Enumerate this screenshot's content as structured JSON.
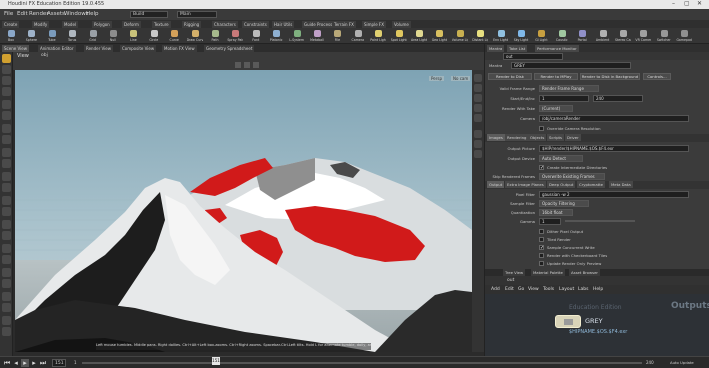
{
  "window": {
    "title": "Houdini FX Education Edition 19.0.455"
  },
  "menu": {
    "items": [
      "File",
      "Edit",
      "Render",
      "Assets",
      "Windows",
      "Help"
    ],
    "desktop": "Build",
    "network_field": "Main"
  },
  "shelf_tabs": [
    "Create",
    "Modify",
    "Model",
    "Polygon",
    "Deform",
    "Texture",
    "Rigging",
    "Characters",
    "Constraints",
    "Hair Utils",
    "Guide Process",
    "Terrain FX",
    "Simple FX",
    "Volume"
  ],
  "shelf_tools": [
    {
      "label": "Box",
      "color": "#8aa7c8"
    },
    {
      "label": "Sphere",
      "color": "#9fb3c9"
    },
    {
      "label": "Tube",
      "color": "#7a9bbc"
    },
    {
      "label": "Torus",
      "color": "#b0b8c0"
    },
    {
      "label": "Grid",
      "color": "#9aa0a6"
    },
    {
      "label": "Null",
      "color": "#8c8c8c"
    },
    {
      "label": "Line",
      "color": "#c9c27a"
    },
    {
      "label": "Circle",
      "color": "#c8c8c8"
    },
    {
      "label": "Curve",
      "color": "#d3a05a"
    },
    {
      "label": "Draw Curve",
      "color": "#d4b06a"
    },
    {
      "label": "Path",
      "color": "#a6b98c"
    },
    {
      "label": "Spray Paint",
      "color": "#c97a7a"
    },
    {
      "label": "Font",
      "color": "#bbbbbb"
    },
    {
      "label": "Platonic",
      "color": "#8fb0d1"
    },
    {
      "label": "L-System",
      "color": "#7fb07f"
    },
    {
      "label": "Metaball",
      "color": "#c0a0c8"
    },
    {
      "label": "File",
      "color": "#b8a878"
    },
    {
      "label": "Camera",
      "color": "#b0b0b0"
    },
    {
      "label": "Point Light",
      "color": "#e0d070"
    },
    {
      "label": "Spot Light",
      "color": "#e0c860"
    },
    {
      "label": "Area Light",
      "color": "#e0d890"
    },
    {
      "label": "Geo Light",
      "color": "#d8c060"
    },
    {
      "label": "Volume Light",
      "color": "#c8b050"
    },
    {
      "label": "Distant Light",
      "color": "#e8e080"
    },
    {
      "label": "Env Light",
      "color": "#90c0e0"
    },
    {
      "label": "Sky Light",
      "color": "#80b8e8"
    },
    {
      "label": "GI Light",
      "color": "#c8a040"
    },
    {
      "label": "Caustic",
      "color": "#a0c8a0"
    },
    {
      "label": "Portal",
      "color": "#9090c8"
    },
    {
      "label": "Ambient",
      "color": "#b0b0b0"
    },
    {
      "label": "Stereo Cam",
      "color": "#a8a8a8"
    },
    {
      "label": "VR Camera",
      "color": "#a0a0a0"
    },
    {
      "label": "Switcher",
      "color": "#989898"
    },
    {
      "label": "Gamepad",
      "color": "#909090"
    }
  ],
  "pane_tabs": [
    "Scene View",
    "Animation Editor",
    "Render View",
    "Composite View",
    "Motion FX View",
    "Geometry Spreadsheet"
  ],
  "viewport": {
    "label": "View",
    "path": "obj",
    "status_text": "Left mouse tumbles. Middle pans. Right dollies. Ctrl+Alt+Left box-zooms. Ctrl+Right zooms. Spacebar-Ctrl-Left tilts. Hold L for alternate tumble, dolly, and zoom.",
    "persp_label": "Persp",
    "cam_label": "No cam"
  },
  "timeline": {
    "current_frame": "151",
    "start": "1",
    "end": "240",
    "right_label": "Auto Update"
  },
  "params": {
    "tabs": [
      "Mantra",
      "Take List",
      "Performance Monitor"
    ],
    "path": "out",
    "node_type": "Mantra",
    "node_name": "GREY",
    "buttons": [
      "Render to Disk",
      "Render to MPlay",
      "Render to Disk in Background",
      "Controls..."
    ],
    "valid_frame_range_label": "Valid Frame Range",
    "valid_frame_range_value": "Render Frame Range",
    "start_end_inc_label": "Start/End/Inc",
    "start_value": "1",
    "end_value": "240",
    "render_with_take_label": "Render With Take",
    "render_with_take_value": "(Current)",
    "camera_label": "Camera",
    "camera_value": "/obj/cameraRender",
    "override_resolution_label": "Override Camera Resolution",
    "section_tabs": [
      "Images",
      "Rendering",
      "Objects",
      "Scripts",
      "Driver"
    ],
    "output_picture_label": "Output Picture",
    "output_picture_value": "$HIP/render/$HIPNAME.$OS.$F4.exr",
    "output_device_label": "Output Device",
    "output_device_value": "Auto Detect",
    "create_dirs_label": "Create Intermediate Directories",
    "skip_rendered_label": "Skip Rendered Frames",
    "skip_rendered_value": "Overwrite Existing Frames",
    "sub_tabs": [
      "Output",
      "Extra Image Planes",
      "Deep Output",
      "Cryptomatte",
      "Meta Data"
    ],
    "pixel_filter_label": "Pixel Filter",
    "pixel_filter_value": "gaussian -w 2",
    "sample_filter_label": "Sample Filter",
    "sample_filter_value": "Opacity Filtering",
    "quantization_label": "Quantization",
    "quantization_value": "16bit float",
    "gamma_label": "Gamma",
    "gamma_value": "1",
    "options": [
      "Dither Pixel Output",
      "Tiled Render",
      "Sample Concurrent Write",
      "Render with Checkerboard Tiles",
      "Update Render Only Preview"
    ]
  },
  "network": {
    "tabs": [
      "Tree View",
      "Material Palette",
      "Asset Browser"
    ],
    "path": "out",
    "menu": [
      "Add",
      "Edit",
      "Go",
      "View",
      "Tools",
      "Layout",
      "Labs",
      "Help"
    ],
    "edition_label": "Education Edition",
    "context_label": "Outputs",
    "node_name": "GREY",
    "node_output": "$HIPNAME.$OS.$F4.exr"
  }
}
